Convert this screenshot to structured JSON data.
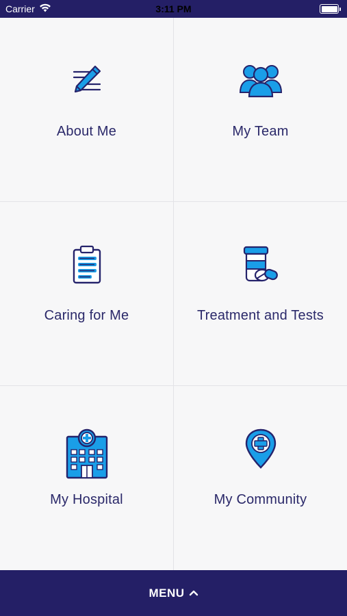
{
  "status_bar": {
    "carrier": "Carrier",
    "time": "3:11 PM"
  },
  "tiles": [
    {
      "label": "About Me",
      "icon": "pencil-notes-icon"
    },
    {
      "label": "My Team",
      "icon": "team-people-icon"
    },
    {
      "label": "Caring for Me",
      "icon": "clipboard-icon"
    },
    {
      "label": "Treatment and Tests",
      "icon": "pill-bottle-icon"
    },
    {
      "label": "My Hospital",
      "icon": "hospital-building-icon"
    },
    {
      "label": "My Community",
      "icon": "location-cross-icon"
    }
  ],
  "menu": {
    "label": "MENU",
    "icon": "chevron-up-icon"
  },
  "colors": {
    "navy": "#241f66",
    "label_text": "#2a2869",
    "icon_blue": "#1a9ee8",
    "icon_outline": "#25236b",
    "background": "#f7f7f8"
  }
}
